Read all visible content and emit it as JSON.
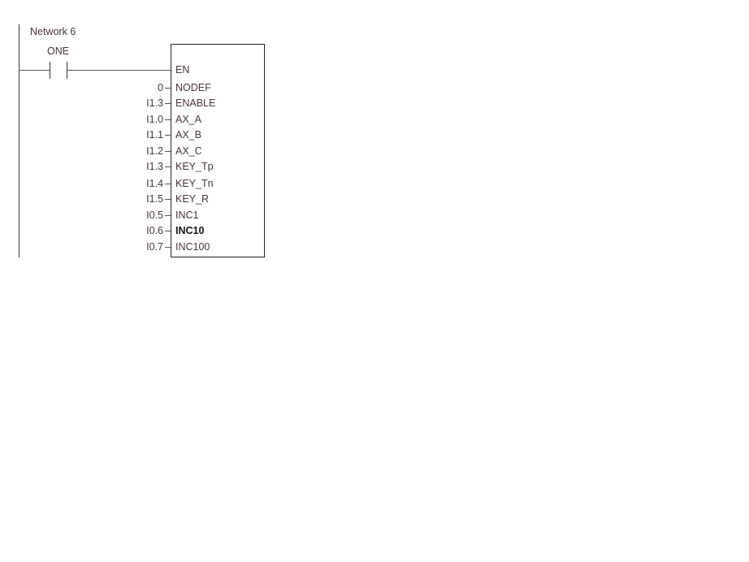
{
  "network": {
    "title": "Network 6"
  },
  "contact": {
    "label": "ONE"
  },
  "block": {
    "enable_pin": "EN",
    "inputs": [
      {
        "address": "0",
        "pin": "NODEF"
      },
      {
        "address": "I1.3",
        "pin": "ENABLE"
      },
      {
        "address": "I1.0",
        "pin": "AX_A"
      },
      {
        "address": "I1.1",
        "pin": "AX_B"
      },
      {
        "address": "I1.2",
        "pin": "AX_C"
      },
      {
        "address": "I1.3",
        "pin": "KEY_Tp"
      },
      {
        "address": "I1.4",
        "pin": "KEY_Tn"
      },
      {
        "address": "I1.5",
        "pin": "KEY_R"
      },
      {
        "address": "I0.5",
        "pin": "INC1"
      },
      {
        "address": "I0.6",
        "pin": "INC10"
      },
      {
        "address": "I0.7",
        "pin": "INC100"
      }
    ]
  }
}
